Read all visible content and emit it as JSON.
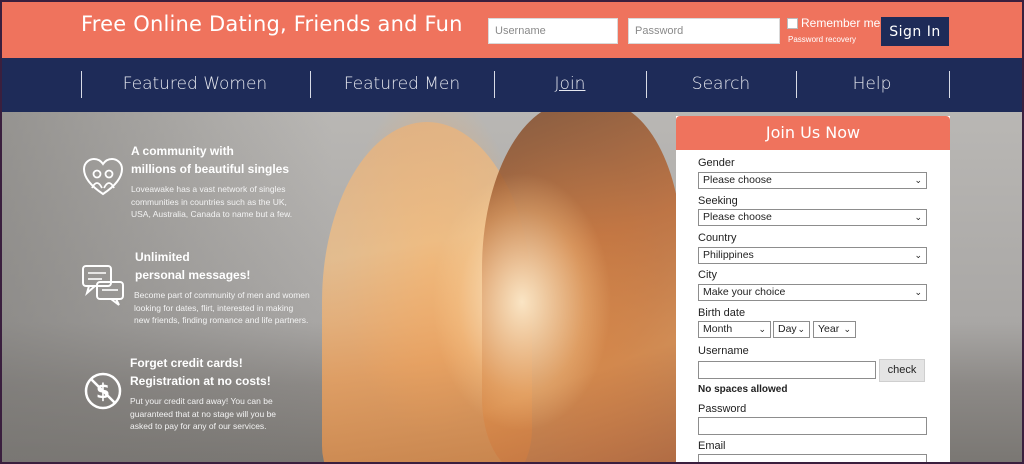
{
  "header": {
    "title": "Free Online Dating, Friends and Fun",
    "username_placeholder": "Username",
    "password_placeholder": "Password",
    "remember_label": "Remember me",
    "password_recovery": "Password recovery",
    "signin_label": "Sign In"
  },
  "nav": {
    "items": [
      {
        "label": "Featured Women"
      },
      {
        "label": "Featured Men"
      },
      {
        "label": "Join",
        "active": true
      },
      {
        "label": "Search"
      },
      {
        "label": "Help"
      }
    ]
  },
  "features": [
    {
      "icon": "couple-heart-icon",
      "title_line1": "A community with",
      "title_line2": "millions of beautiful singles",
      "desc_line1": "Loveawake has a vast network of singles",
      "desc_line2": "communities in countries such as the UK,",
      "desc_line3": "USA, Australia, Canada to name but a few."
    },
    {
      "icon": "chat-bubbles-icon",
      "title_line1": "Unlimited",
      "title_line2": "personal messages!",
      "desc_line1": "Become part of community of men and women",
      "desc_line2": "looking for dates, flirt, interested in making",
      "desc_line3": "new friends, finding romance and life partners."
    },
    {
      "icon": "no-dollar-icon",
      "title_line1": "Forget credit cards!",
      "title_line2": "Registration at no costs!",
      "desc_line1": "Put your credit card away! You can be",
      "desc_line2": "guaranteed that at no stage will you be",
      "desc_line3": "asked to pay for any of our services."
    }
  ],
  "join": {
    "title": "Join Us Now",
    "gender_label": "Gender",
    "gender_value": "Please choose",
    "seeking_label": "Seeking",
    "seeking_value": "Please choose",
    "country_label": "Country",
    "country_value": "Philippines",
    "city_label": "City",
    "city_value": "Make your choice",
    "birthdate_label": "Birth date",
    "month_value": "Month",
    "day_value": "Day",
    "year_value": "Year",
    "username_label": "Username",
    "check_label": "check",
    "no_spaces_note": "No spaces allowed",
    "password_label": "Password",
    "email_label": "Email"
  },
  "colors": {
    "coral": "#ef735d",
    "navy": "#1e2b58"
  }
}
